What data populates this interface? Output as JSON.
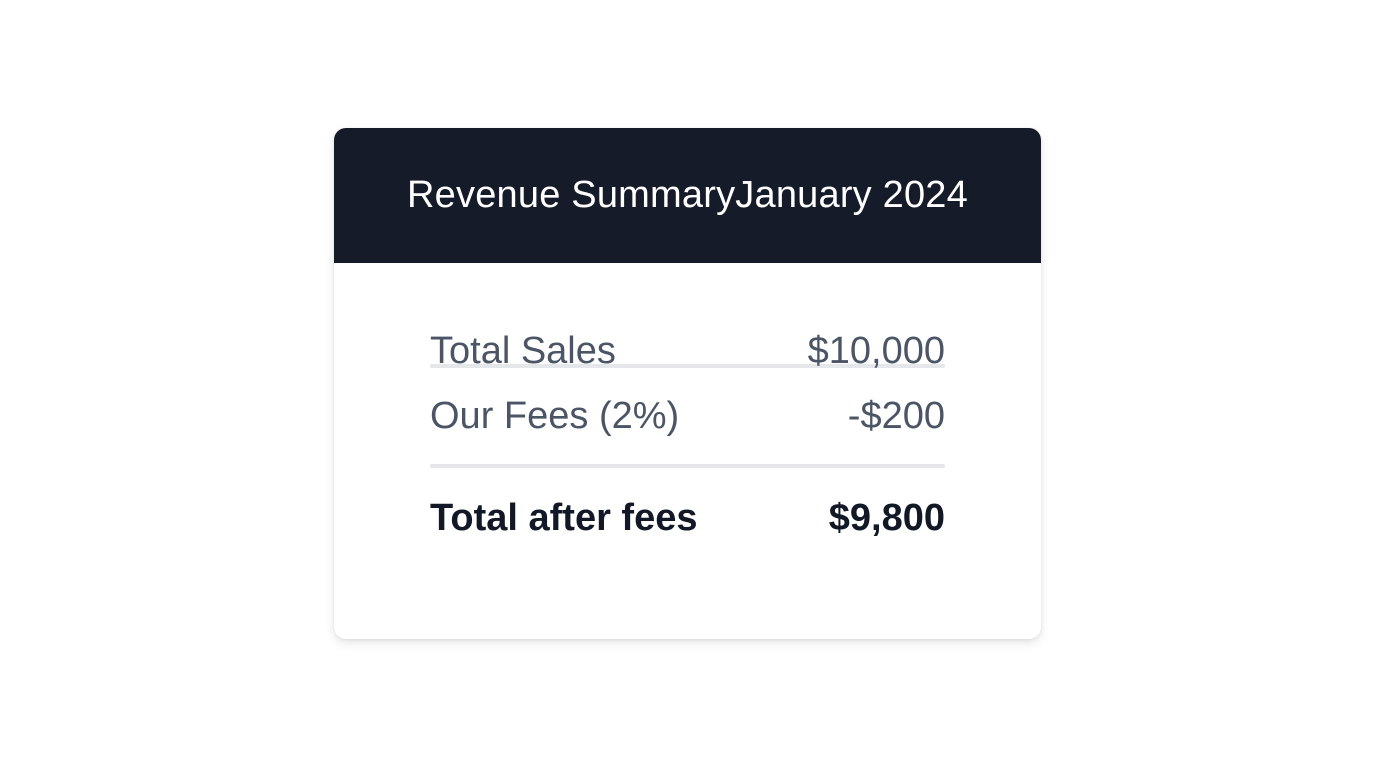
{
  "summary": {
    "title": "Revenue Summary",
    "period": "January 2024",
    "rows": [
      {
        "label": "Total Sales",
        "value": "$10,000"
      },
      {
        "label": "Our Fees (2%)",
        "value": "-$200"
      }
    ],
    "total": {
      "label": "Total after fees",
      "value": "$9,800"
    }
  },
  "colors": {
    "header_bg": "#151b28",
    "header_text": "#ffffff",
    "row_text": "#4b5565",
    "total_text": "#121826",
    "divider": "#e5e7eb"
  }
}
